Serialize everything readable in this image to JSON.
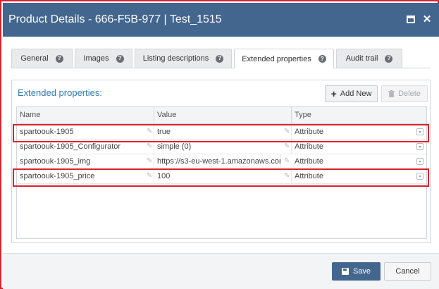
{
  "window": {
    "title": "Product Details - 666-F5B-977 | Test_1515"
  },
  "tabs": [
    {
      "label": "General"
    },
    {
      "label": "Images"
    },
    {
      "label": "Listing descriptions"
    },
    {
      "label": "Extended properties",
      "active": true
    },
    {
      "label": "Audit trail"
    }
  ],
  "panel": {
    "title": "Extended properties:",
    "add_label": "Add New",
    "delete_label": "Delete"
  },
  "grid": {
    "columns": [
      "Name",
      "Value",
      "Type"
    ],
    "rows": [
      {
        "name": "spartoouk-1905",
        "value": "true",
        "type": "Attribute",
        "highlighted": true
      },
      {
        "name": "spartoouk-1905_Configurator",
        "value": "simple (0)",
        "type": "Attribute",
        "highlighted": false
      },
      {
        "name": "spartoouk-1905_img",
        "value": "https://s3-eu-west-1.amazonaws.com...",
        "type": "Attribute",
        "highlighted": false
      },
      {
        "name": "spartoouk-1905_price",
        "value": "100",
        "type": "Attribute",
        "highlighted": true
      }
    ]
  },
  "footer": {
    "save_label": "Save",
    "cancel_label": "Cancel"
  },
  "icons": {
    "help": "question-circle-icon",
    "edit": "pencil-icon",
    "dropdown": "dropdown-icon",
    "save": "floppy-disk-icon",
    "add": "plus-icon",
    "delete": "trash-icon",
    "maximize": "maximize-icon",
    "close": "close-icon"
  },
  "colors": {
    "titlebar": "#43668f",
    "accent": "#2c7bb8",
    "highlight": "#d9232e"
  }
}
